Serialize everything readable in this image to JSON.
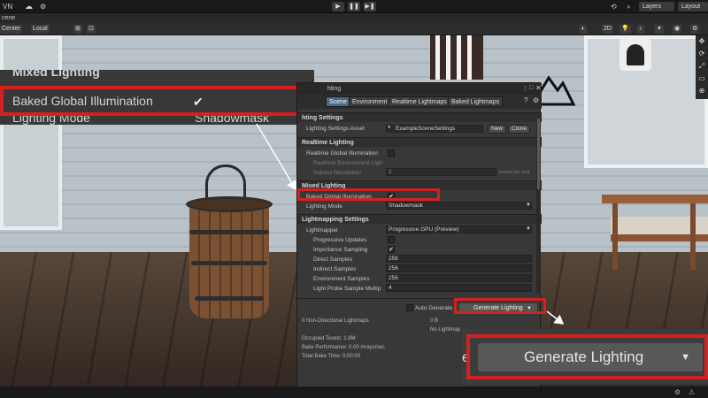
{
  "topbar": {
    "account": "VN",
    "layers": "Layers",
    "layout": "Layout",
    "play": "▶",
    "pause": "❚❚",
    "step": "▶❚"
  },
  "scene_tab": "cene",
  "scene_toolbar": {
    "pivot": "Center",
    "space": "Local",
    "mode_2d": "2D"
  },
  "zoom_top": {
    "section": "Mixed Lighting",
    "baked_gi_label": "Baked Global Illumination",
    "baked_gi_value": "✔",
    "lighting_mode_label": "Lighting Mode",
    "lighting_mode_value": "Shadowmask"
  },
  "panel": {
    "title": "hting",
    "tabs": [
      "Scene",
      "Environment",
      "Realtime Lightmaps",
      "Baked Lightmaps"
    ],
    "lighting_settings_header": "hting Settings",
    "lighting_settings_asset_label": "Lighting Settings Asset",
    "lighting_settings_asset_value": "ExampleSceneSettings",
    "new_label": "New",
    "clone_label": "Clone",
    "realtime_header": "Realtime Lighting",
    "realtime_gi_label": "Realtime Global Illumination",
    "realtime_env_label": "Realtime Environment Ligh",
    "indirect_res_label": "Indirect Resolution",
    "indirect_res_value": "2",
    "indirect_res_unit": "texels per unit",
    "mixed_header": "Mixed Lighting",
    "baked_gi_label": "Baked Global Illumination",
    "baked_gi_check": "✔",
    "lighting_mode_label": "Lighting Mode",
    "lighting_mode_value": "Shadowmask",
    "lightmapping_header": "Lightmapping Settings",
    "lightmapper_label": "Lightmapper",
    "lightmapper_value": "Progressive GPU (Preview)",
    "progressive_updates_label": "Progressive Updates",
    "importance_sampling_label": "Importance Sampling",
    "importance_sampling_check": "✔",
    "direct_samples_label": "Direct Samples",
    "direct_samples_value": "256",
    "indirect_samples_label": "Indirect Samples",
    "indirect_samples_value": "256",
    "environment_samples_label": "Environment Samples",
    "environment_samples_value": "256",
    "light_probe_label": "Light Probe Sample Multip",
    "light_probe_value": "4",
    "auto_generate_label": "Auto Generate",
    "generate_label": "Generate Lighting",
    "non_directional": "0 Non-Directional Lightmaps",
    "size_value": "0 B",
    "no_lightmaps": "No Lightmap",
    "occupied_texels": "Occupied Texels: 1.9M",
    "bake_performance": "Bake Performance: 0.00 mrays/sec",
    "total_bake_time": "Total Bake Time: 0:00:00"
  },
  "zoom_bottom": {
    "edge_text": "e",
    "generate_label": "Generate Lighting",
    "dropdown_glyph": "▼"
  },
  "colors": {
    "highlight": "#d52020",
    "active_tab": "#4a6a8a"
  }
}
